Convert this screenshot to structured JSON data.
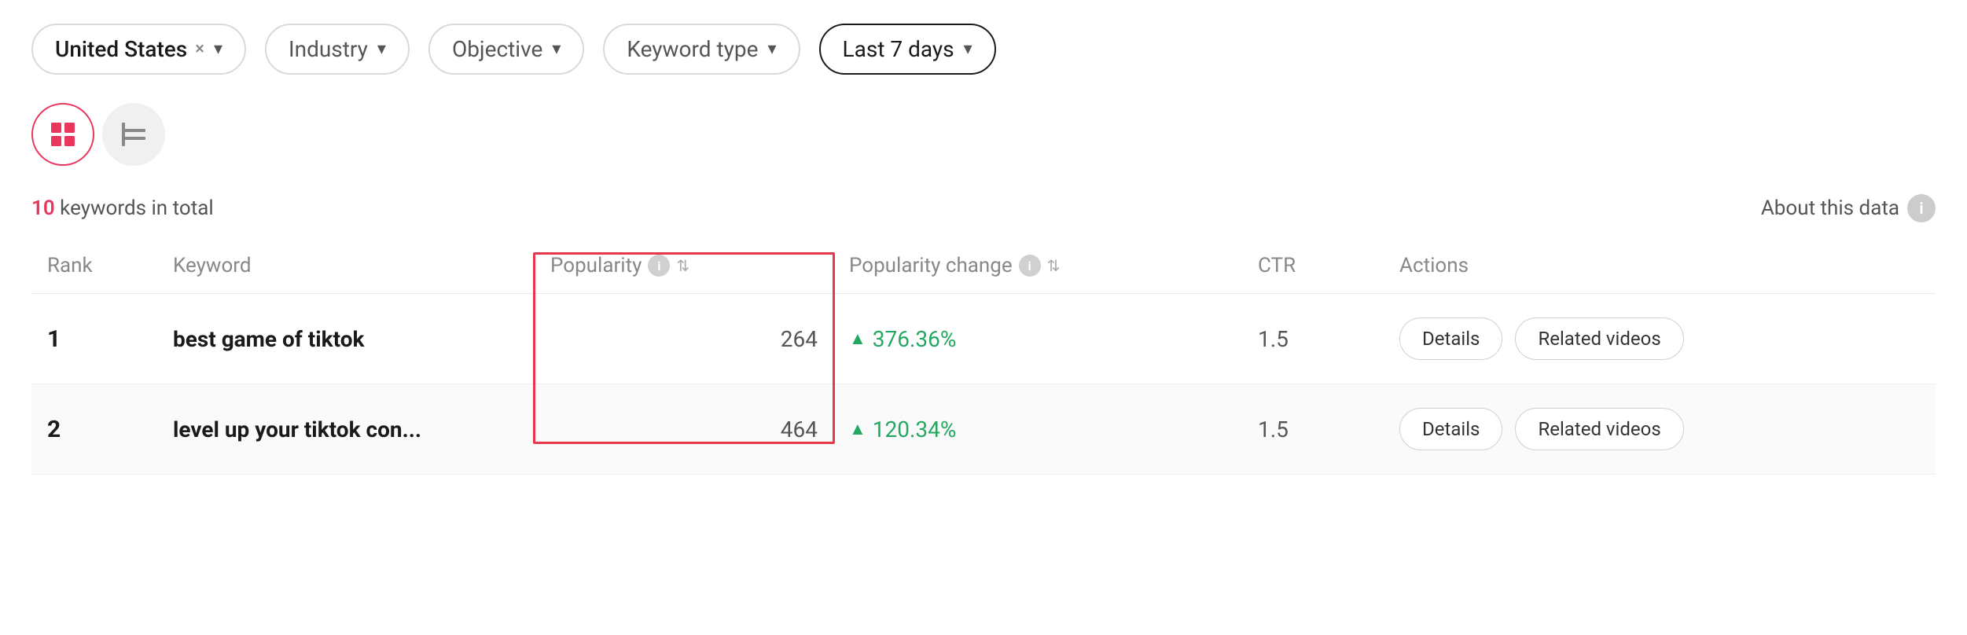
{
  "filters": {
    "country": {
      "label": "United States",
      "hasClose": true
    },
    "industry": {
      "label": "Industry"
    },
    "objective": {
      "label": "Objective"
    },
    "keyword_type": {
      "label": "Keyword type"
    },
    "date_range": {
      "label": "Last 7 days"
    }
  },
  "view_toggle": {
    "table_icon": "⊞",
    "chart_icon": "⊟"
  },
  "stats": {
    "count": "10",
    "count_label": "keywords in total"
  },
  "about_data": {
    "label": "About this data"
  },
  "table": {
    "headers": {
      "rank": "Rank",
      "keyword": "Keyword",
      "popularity": "Popularity",
      "popularity_change": "Popularity change",
      "ctr": "CTR",
      "actions": "Actions"
    },
    "rows": [
      {
        "rank": "1",
        "keyword": "best game of tiktok",
        "popularity": "264",
        "popularity_change": "376.36%",
        "ctr": "1.5",
        "details_label": "Details",
        "related_videos_label": "Related videos"
      },
      {
        "rank": "2",
        "keyword": "level up your tiktok con...",
        "popularity": "464",
        "popularity_change": "120.34%",
        "ctr": "1.5",
        "details_label": "Details",
        "related_videos_label": "Related videos"
      }
    ]
  }
}
